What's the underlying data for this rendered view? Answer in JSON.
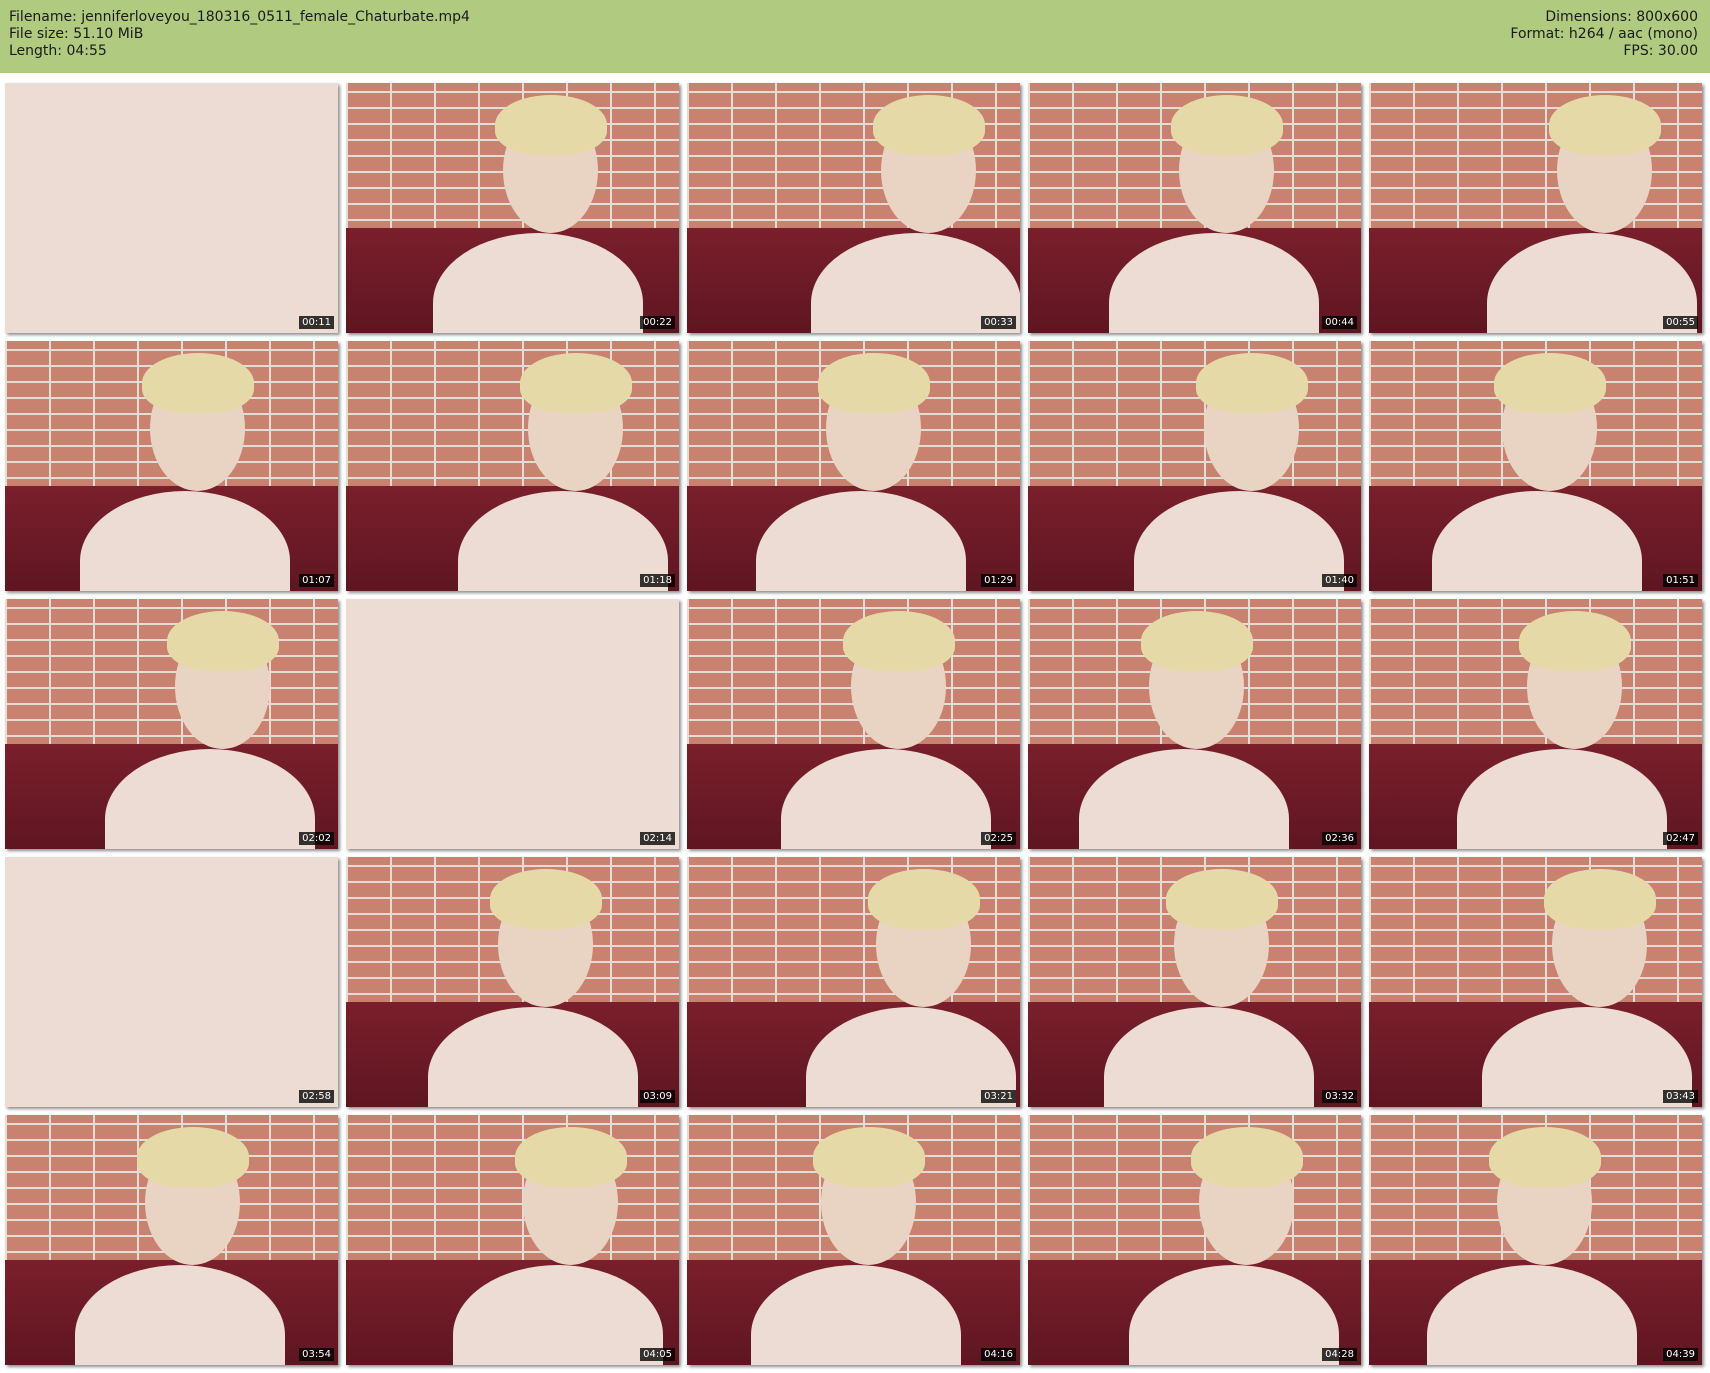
{
  "header": {
    "filename_label": "Filename: jenniferloveyou_180316_0511_female_Chaturbate.mp4",
    "filesize_label": "File size: 51.10 MiB",
    "length_label": "Length: 04:55",
    "dimensions_label": "Dimensions: 800x600",
    "format_label": "Format: h264 / aac (mono)",
    "fps_label": "FPS: 30.00",
    "background_color": "#b0cb7f"
  },
  "thumbnails": [
    {
      "time": "00:11",
      "type": "closeup"
    },
    {
      "time": "00:22",
      "type": "portrait"
    },
    {
      "time": "00:33",
      "type": "portrait"
    },
    {
      "time": "00:44",
      "type": "portrait"
    },
    {
      "time": "00:55",
      "type": "portrait"
    },
    {
      "time": "01:07",
      "type": "portrait"
    },
    {
      "time": "01:18",
      "type": "portrait"
    },
    {
      "time": "01:29",
      "type": "portrait"
    },
    {
      "time": "01:40",
      "type": "portrait"
    },
    {
      "time": "01:51",
      "type": "portrait"
    },
    {
      "time": "02:02",
      "type": "portrait"
    },
    {
      "time": "02:14",
      "type": "closeup"
    },
    {
      "time": "02:25",
      "type": "portrait"
    },
    {
      "time": "02:36",
      "type": "portrait"
    },
    {
      "time": "02:47",
      "type": "portrait"
    },
    {
      "time": "02:58",
      "type": "closeup"
    },
    {
      "time": "03:09",
      "type": "portrait"
    },
    {
      "time": "03:21",
      "type": "portrait"
    },
    {
      "time": "03:32",
      "type": "portrait"
    },
    {
      "time": "03:43",
      "type": "portrait"
    },
    {
      "time": "03:54",
      "type": "portrait"
    },
    {
      "time": "04:05",
      "type": "portrait"
    },
    {
      "time": "04:16",
      "type": "portrait"
    },
    {
      "time": "04:28",
      "type": "portrait"
    },
    {
      "time": "04:39",
      "type": "portrait"
    }
  ]
}
